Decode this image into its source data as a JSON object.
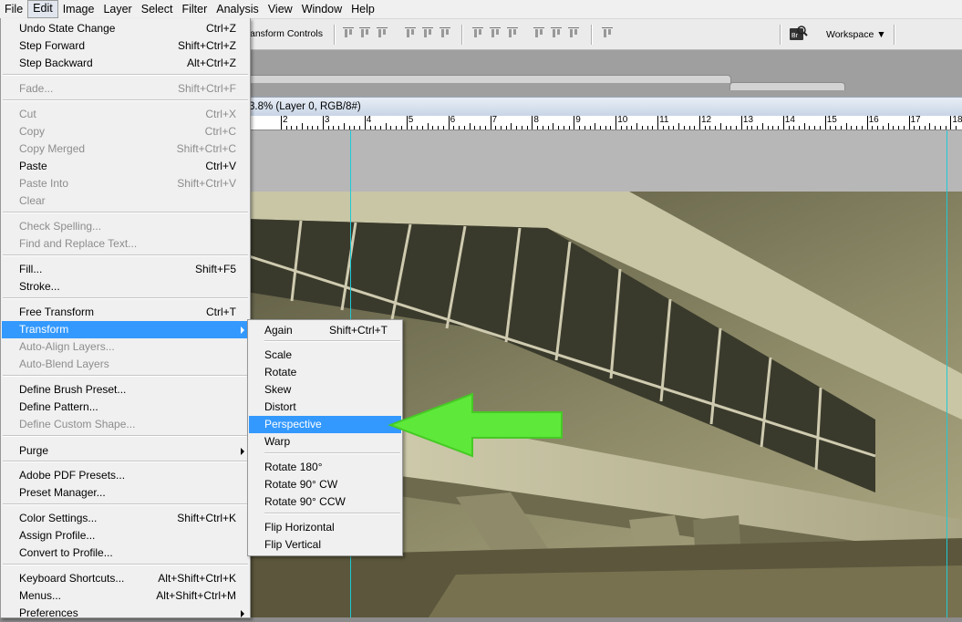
{
  "menubar": [
    "File",
    "Edit",
    "Image",
    "Layer",
    "Select",
    "Filter",
    "Analysis",
    "View",
    "Window",
    "Help"
  ],
  "menubar_active": "Edit",
  "optionsbar": {
    "transform_controls": "ansform Controls",
    "workspace": "Workspace"
  },
  "document": {
    "title": "3.8% (Layer 0, RGB/8#)"
  },
  "ruler": [
    "2",
    "3",
    "4",
    "5",
    "6",
    "7",
    "8",
    "9",
    "10",
    "11",
    "12",
    "13",
    "14",
    "15",
    "16",
    "17",
    "18"
  ],
  "edit_menu": {
    "items": [
      {
        "label": "Undo State Change",
        "shortcut": "Ctrl+Z",
        "disabled": false
      },
      {
        "label": "Step Forward",
        "shortcut": "Shift+Ctrl+Z",
        "disabled": false
      },
      {
        "label": "Step Backward",
        "shortcut": "Alt+Ctrl+Z",
        "disabled": false
      },
      {
        "label": "Fade...",
        "shortcut": "Shift+Ctrl+F",
        "disabled": true
      },
      {
        "label": "Cut",
        "shortcut": "Ctrl+X",
        "disabled": true
      },
      {
        "label": "Copy",
        "shortcut": "Ctrl+C",
        "disabled": true
      },
      {
        "label": "Copy Merged",
        "shortcut": "Shift+Ctrl+C",
        "disabled": true
      },
      {
        "label": "Paste",
        "shortcut": "Ctrl+V",
        "disabled": false
      },
      {
        "label": "Paste Into",
        "shortcut": "Shift+Ctrl+V",
        "disabled": true
      },
      {
        "label": "Clear",
        "shortcut": "",
        "disabled": true
      },
      {
        "label": "Check Spelling...",
        "shortcut": "",
        "disabled": true
      },
      {
        "label": "Find and Replace Text...",
        "shortcut": "",
        "disabled": true
      },
      {
        "label": "Fill...",
        "shortcut": "Shift+F5",
        "disabled": false
      },
      {
        "label": "Stroke...",
        "shortcut": "",
        "disabled": false
      },
      {
        "label": "Free Transform",
        "shortcut": "Ctrl+T",
        "disabled": false
      },
      {
        "label": "Transform",
        "shortcut": "",
        "disabled": false,
        "submenu": true,
        "highlighted": true
      },
      {
        "label": "Auto-Align Layers...",
        "shortcut": "",
        "disabled": true
      },
      {
        "label": "Auto-Blend Layers",
        "shortcut": "",
        "disabled": true
      },
      {
        "label": "Define Brush Preset...",
        "shortcut": "",
        "disabled": false
      },
      {
        "label": "Define Pattern...",
        "shortcut": "",
        "disabled": false
      },
      {
        "label": "Define Custom Shape...",
        "shortcut": "",
        "disabled": true
      },
      {
        "label": "Purge",
        "shortcut": "",
        "disabled": false,
        "submenu": true
      },
      {
        "label": "Adobe PDF Presets...",
        "shortcut": "",
        "disabled": false
      },
      {
        "label": "Preset Manager...",
        "shortcut": "",
        "disabled": false
      },
      {
        "label": "Color Settings...",
        "shortcut": "Shift+Ctrl+K",
        "disabled": false
      },
      {
        "label": "Assign Profile...",
        "shortcut": "",
        "disabled": false
      },
      {
        "label": "Convert to Profile...",
        "shortcut": "",
        "disabled": false
      },
      {
        "label": "Keyboard Shortcuts...",
        "shortcut": "Alt+Shift+Ctrl+K",
        "disabled": false
      },
      {
        "label": "Menus...",
        "shortcut": "Alt+Shift+Ctrl+M",
        "disabled": false
      },
      {
        "label": "Preferences",
        "shortcut": "",
        "disabled": false,
        "submenu": true
      }
    ]
  },
  "transform_menu": {
    "items": [
      {
        "label": "Again",
        "shortcut": "Shift+Ctrl+T"
      },
      {
        "label": "Scale",
        "shortcut": ""
      },
      {
        "label": "Rotate",
        "shortcut": ""
      },
      {
        "label": "Skew",
        "shortcut": ""
      },
      {
        "label": "Distort",
        "shortcut": ""
      },
      {
        "label": "Perspective",
        "shortcut": "",
        "highlighted": true
      },
      {
        "label": "Warp",
        "shortcut": ""
      },
      {
        "label": "Rotate 180°",
        "shortcut": ""
      },
      {
        "label": "Rotate 90° CW",
        "shortcut": ""
      },
      {
        "label": "Rotate 90° CCW",
        "shortcut": ""
      },
      {
        "label": "Flip Horizontal",
        "shortcut": ""
      },
      {
        "label": "Flip Vertical",
        "shortcut": ""
      }
    ]
  },
  "colors": {
    "highlight": "#3399ff",
    "guide": "#20c8d6",
    "annotation_arrow": "#5ee83a"
  }
}
